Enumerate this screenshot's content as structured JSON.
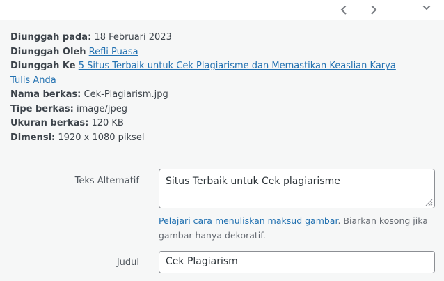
{
  "nav": {
    "prev_icon": "chevron-left-icon",
    "next_icon": "chevron-right-icon",
    "close_icon": "close-icon"
  },
  "details": {
    "uploaded_on_label": "Diunggah pada:",
    "uploaded_on_value": "18 Februari 2023",
    "uploaded_by_label": "Diunggah Oleh",
    "uploaded_by_value": "Refli Puasa",
    "uploaded_to_label": "Diunggah Ke",
    "uploaded_to_value": "5 Situs Terbaik untuk Cek Plagiarisme dan Memastikan Keaslian Karya Tulis Anda",
    "file_name_label": "Nama berkas:",
    "file_name_value": "Cek-Plagiarism.jpg",
    "file_type_label": "Tipe berkas:",
    "file_type_value": "image/jpeg",
    "file_size_label": "Ukuran berkas:",
    "file_size_value": "120 KB",
    "dimensions_label": "Dimensi:",
    "dimensions_value": "1920 x 1080 piksel"
  },
  "form": {
    "alt_label": "Teks Alternatif",
    "alt_value": "Situs Terbaik untuk Cek plagiarisme",
    "help_link": "Pelajari cara menuliskan maksud gambar",
    "help_text": ". Biarkan kosong jika gambar hanya dekoratif.",
    "title_label": "Judul",
    "title_value": "Cek Plagiarism"
  },
  "colors": {
    "link": "#2271b1",
    "background": "#f6f7f7",
    "border": "#8c8f94"
  }
}
